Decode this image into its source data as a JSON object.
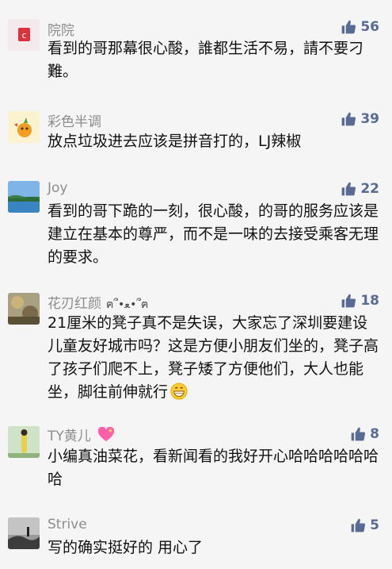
{
  "comments": [
    {
      "nickname": "院院",
      "text": "看到的哥那幕很心酸，誰都生活不易，請不要刁難。",
      "likes": "56"
    },
    {
      "nickname": "彩色半调",
      "text": "放点垃圾进去应该是拼音打的，LJ辣椒",
      "likes": "39"
    },
    {
      "nickname": "Joy",
      "text": "看到的哥下跪的一刻，很心酸，的哥的服务应该是建立在基本的尊严，而不是一味的去接受乘客无理的要求。",
      "likes": "22"
    },
    {
      "nickname": "花刃红颜",
      "nickname_suffix": "ฅ՞•ﻌ•՞ฅ",
      "text": "21厘米的凳子真不是失误，大家忘了深圳要建设儿童友好城市吗？这是方便小朋友们坐的，凳子高了孩子们爬不上，凳子矮了方便他们，大人也能坐，脚往前伸就行",
      "likes": "18"
    },
    {
      "nickname": "TY黄儿",
      "text": "小编真油菜花，看新闻看的我好开心哈哈哈哈哈哈哈",
      "likes": "8"
    },
    {
      "nickname": "Strive",
      "text": "写的确实挺好的 用心了",
      "likes": "5"
    }
  ],
  "icons": {
    "like": "thumbs-up-icon",
    "grin": "grinning-face-emoji",
    "heart": "sparkling-heart-emoji"
  },
  "colors": {
    "like": "#576b95",
    "nickname": "#8c8c8c",
    "text": "#111111",
    "background": "#f5f5f5"
  }
}
